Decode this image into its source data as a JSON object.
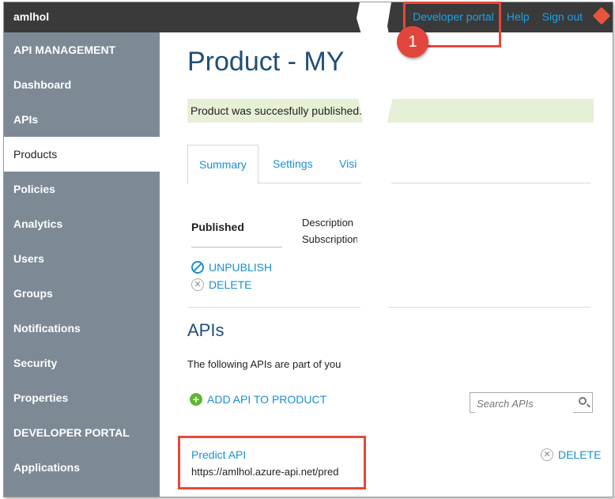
{
  "topbar": {
    "brand": "amlhol",
    "links": [
      "Developer portal",
      "Help",
      "Sign out"
    ]
  },
  "sidebar": {
    "items": [
      {
        "label": "API MANAGEMENT",
        "type": "header"
      },
      {
        "label": "Dashboard"
      },
      {
        "label": "APIs"
      },
      {
        "label": "Products",
        "active": true
      },
      {
        "label": "Policies"
      },
      {
        "label": "Analytics"
      },
      {
        "label": "Users"
      },
      {
        "label": "Groups"
      },
      {
        "label": "Notifications"
      },
      {
        "label": "Security"
      },
      {
        "label": "Properties"
      },
      {
        "label": "DEVELOPER PORTAL",
        "type": "header"
      },
      {
        "label": "Applications"
      }
    ]
  },
  "main": {
    "title": "Product - MY",
    "notice": "Product was succesfully published.",
    "tabs": [
      "Summary",
      "Settings",
      "Visi"
    ],
    "status_label": "Published",
    "desc_lines": [
      "Description",
      "Subscription"
    ],
    "unpublish_label": "UNPUBLISH",
    "delete_label": "DELETE",
    "apis_title": "APIs",
    "apis_desc": "The following APIs are part of you",
    "add_api_label": "ADD API TO PRODUCT",
    "search_placeholder": "Search APIs",
    "api": {
      "name": "Predict API",
      "url": "https://amlhol.azure-api.net/pred",
      "delete_label": "DELETE"
    }
  },
  "annotation": {
    "badge": "1",
    "accent_color": "#e8473a"
  }
}
